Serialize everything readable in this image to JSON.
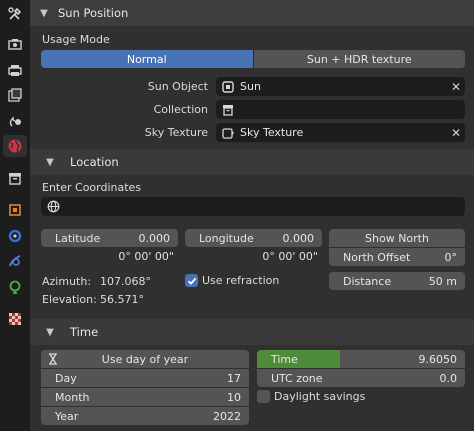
{
  "sidebar": {
    "tabs": [
      "tool-icon",
      "render-icon",
      "output-icon",
      "view-layer-icon",
      "scene-icon",
      "world-icon",
      "collection-icon",
      "object-icon",
      "modifier-icon",
      "particles-icon",
      "physics-icon",
      "texture-icon"
    ]
  },
  "panel": {
    "title": "Sun Position",
    "usage_mode_label": "Usage Mode",
    "usage_modes": [
      "Normal",
      "Sun + HDR texture"
    ],
    "selected_mode": "Normal",
    "sun_object_label": "Sun Object",
    "sun_object_value": "Sun",
    "collection_label": "Collection",
    "collection_value": "",
    "sky_texture_label": "Sky Texture",
    "sky_texture_value": "Sky Texture"
  },
  "location": {
    "title": "Location",
    "enter_coords_label": "Enter Coordinates",
    "coords_value": "",
    "latitude_label": "Latitude",
    "latitude_value": "0.000",
    "latitude_dms": "0° 00' 00\"",
    "longitude_label": "Longitude",
    "longitude_value": "0.000",
    "longitude_dms": "0° 00' 00\"",
    "show_north_label": "Show North",
    "north_offset_label": "North Offset",
    "north_offset_value": "0°",
    "azimuth_label": "Azimuth:",
    "azimuth_value": "107.068°",
    "elevation_label": "Elevation:",
    "elevation_value": "56.571°",
    "use_refraction_label": "Use refraction",
    "use_refraction_checked": true,
    "distance_label": "Distance",
    "distance_value": "50 m"
  },
  "time": {
    "title": "Time",
    "use_day_of_year_label": "Use day of year",
    "day_label": "Day",
    "day_value": "17",
    "month_label": "Month",
    "month_value": "10",
    "year_label": "Year",
    "year_value": "2022",
    "time_label": "Time",
    "time_value": "9.6050",
    "time_fill": 0.4,
    "utc_zone_label": "UTC zone",
    "utc_zone_value": "0.0",
    "daylight_savings_label": "Daylight savings",
    "daylight_savings_checked": false
  },
  "colors": {
    "accent_blue": "#4772b3",
    "time_green": "#4f8c3a",
    "field_dark": "#1d1d1d",
    "button_grey": "#545454"
  }
}
